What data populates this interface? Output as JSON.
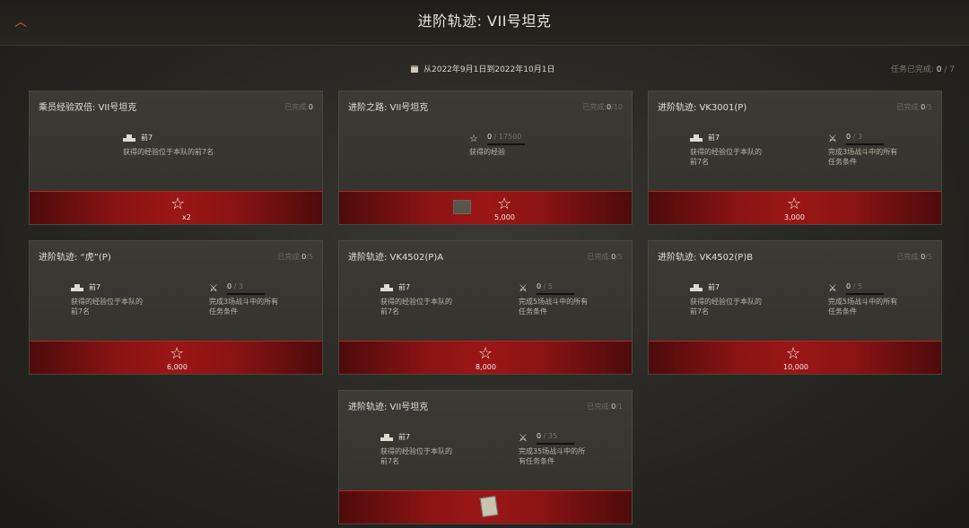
{
  "header": {
    "title": "进阶轨迹: VII号坦克",
    "back_icon": "chevron-up-icon"
  },
  "subheader": {
    "date_range": "从2022年9月1日到2022年10月1日",
    "tasks_label": "任务已完成:",
    "tasks_done": "0",
    "tasks_total": "/ 7"
  },
  "cards": [
    {
      "title": "乘员经验双倍: VII号坦克",
      "progress_label": "已完成:",
      "progress_done": "0",
      "progress_total": "",
      "conditions": [
        {
          "icon": "tank-icon",
          "value": "前7",
          "total": "",
          "desc": "获得的经验位于本队的前7名"
        }
      ],
      "reward": {
        "icon": "star-crew-icon",
        "amount": "x2"
      }
    },
    {
      "title": "进阶之路: VII号坦克",
      "progress_label": "已完成:",
      "progress_done": "0",
      "progress_total": "/10",
      "conditions": [
        {
          "icon": "star-icon",
          "value": "0",
          "total": "/ 17500",
          "desc": "获得的经验"
        }
      ],
      "reward": {
        "icon": "star-icon",
        "amount": "5,000",
        "extra_icon": "tank-item-icon"
      }
    },
    {
      "title": "进阶轨迹: VK3001(P)",
      "progress_label": "已完成:",
      "progress_done": "0",
      "progress_total": "/5",
      "conditions": [
        {
          "icon": "tank-icon",
          "value": "前7",
          "total": "",
          "desc": "获得的经验位于本队的前7名"
        },
        {
          "icon": "crossed-swords-icon",
          "value": "0",
          "total": "/ 3",
          "desc": "完成3场战斗中的所有任务条件"
        }
      ],
      "reward": {
        "icon": "star-icon",
        "amount": "3,000"
      }
    },
    {
      "title": "进阶轨迹: “虎”(P)",
      "progress_label": "已完成:",
      "progress_done": "0",
      "progress_total": "/5",
      "conditions": [
        {
          "icon": "tank-icon",
          "value": "前7",
          "total": "",
          "desc": "获得的经验位于本队的前7名"
        },
        {
          "icon": "crossed-swords-icon",
          "value": "0",
          "total": "/ 3",
          "desc": "完成3场战斗中的所有任务条件"
        }
      ],
      "reward": {
        "icon": "star-icon",
        "amount": "6,000"
      }
    },
    {
      "title": "进阶轨迹: VK4502(P)A",
      "progress_label": "已完成:",
      "progress_done": "0",
      "progress_total": "/5",
      "conditions": [
        {
          "icon": "tank-icon",
          "value": "前7",
          "total": "",
          "desc": "获得的经验位于本队的前7名"
        },
        {
          "icon": "crossed-swords-icon",
          "value": "0",
          "total": "/ 5",
          "desc": "完成5场战斗中的所有任务条件"
        }
      ],
      "reward": {
        "icon": "star-icon",
        "amount": "8,000"
      }
    },
    {
      "title": "进阶轨迹: VK4502(P)B",
      "progress_label": "已完成:",
      "progress_done": "0",
      "progress_total": "/5",
      "conditions": [
        {
          "icon": "tank-icon",
          "value": "前7",
          "total": "",
          "desc": "获得的经验位于本队的前7名"
        },
        {
          "icon": "crossed-swords-icon",
          "value": "0",
          "total": "/ 5",
          "desc": "完成5场战斗中的所有任务条件"
        }
      ],
      "reward": {
        "icon": "star-icon",
        "amount": "10,000"
      }
    },
    {
      "title": "进阶轨迹: VII号坦克",
      "progress_label": "已完成:",
      "progress_done": "0",
      "progress_total": "/1",
      "conditions": [
        {
          "icon": "tank-icon",
          "value": "前7",
          "total": "",
          "desc": "获得的经验位于本队的前7名"
        },
        {
          "icon": "crossed-swords-icon",
          "value": "0",
          "total": "/ 35",
          "desc": "完成35场战斗中的所有任务条件"
        }
      ],
      "reward": {
        "icon": "document-icon",
        "amount": ""
      }
    }
  ],
  "colors": {
    "accent": "#e05a2a",
    "reward_red": "#9c1616",
    "card_bg": "#3a3833"
  }
}
